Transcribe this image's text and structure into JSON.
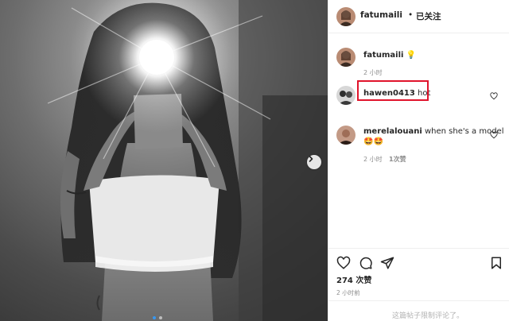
{
  "post": {
    "image": {
      "description_icon": "photo-image",
      "carousel_current": 1,
      "carousel_total": 2
    }
  },
  "header": {
    "username": "fatumaili",
    "separator": "•",
    "follow_status": "已关注"
  },
  "caption": {
    "username": "fatumaili",
    "emoji": "💡",
    "time": "2 小时"
  },
  "comments": [
    {
      "username": "hawen0413",
      "text": "hot",
      "highlighted": true
    },
    {
      "username": "merelalouani",
      "text": "when she's a model",
      "emojis": "🤩🤩",
      "time": "2 小时",
      "likes": "1次赞"
    }
  ],
  "actions": {
    "like_icon": "heart-icon",
    "comment_icon": "comment-icon",
    "share_icon": "share-icon",
    "save_icon": "bookmark-icon"
  },
  "stats": {
    "likes": "274 次赞",
    "time_ago": "2 小时前"
  },
  "footer": {
    "comments_disabled": "这篇帖子限制评论了。"
  },
  "colors": {
    "highlight": "#e0142c",
    "text": "#262626",
    "muted": "#8e8e8e",
    "carousel_active": "#3897f0"
  }
}
